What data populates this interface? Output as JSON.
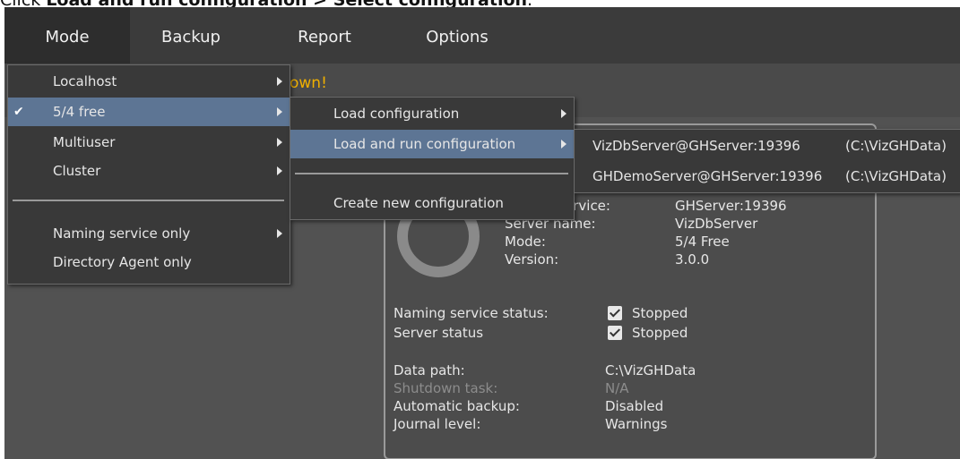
{
  "caption": {
    "prefix": "Click ",
    "bold": "Load and run configuration > Select configuration",
    "suffix": "."
  },
  "menubar": [
    "Mode",
    "Backup",
    "Report",
    "Options"
  ],
  "warning_fragment": "own!",
  "mode_menu": {
    "items": [
      "Localhost",
      "5/4 free",
      "Multiuser",
      "Cluster",
      "Naming service only",
      "Directory Agent only"
    ],
    "checked_index": 1
  },
  "config_menu": {
    "load": "Load configuration",
    "load_run": "Load and run configuration",
    "create": "Create new configuration"
  },
  "server_menu": [
    {
      "name": "VizDbServer@GHServer:19396",
      "path": "(C:\\VizGHData)"
    },
    {
      "name": "GHDemoServer@GHServer:19396",
      "path": "(C:\\VizGHData)"
    }
  ],
  "status": {
    "naming_service_label": "ervice:",
    "naming_service_value": "GHServer:19396",
    "server_name_label": "Server name:",
    "server_name_value": "VizDbServer",
    "mode_label": "Mode:",
    "mode_value": "5/4 Free",
    "version_label": "Version:",
    "version_value": "3.0.0",
    "ns_status_label": "Naming service status:",
    "ns_status_value": "Stopped",
    "server_status_label": "Server status",
    "server_status_value": "Stopped",
    "data_path_label": "Data path:",
    "data_path_value": "C:\\VizGHData",
    "shutdown_label": "Shutdown task:",
    "shutdown_value": "N/A",
    "backup_label": "Automatic backup:",
    "backup_value": "Disabled",
    "journal_label": "Journal level:",
    "journal_value": "Warnings"
  },
  "colors": {
    "highlight": "#5d7594",
    "warning": "#f0b000"
  }
}
